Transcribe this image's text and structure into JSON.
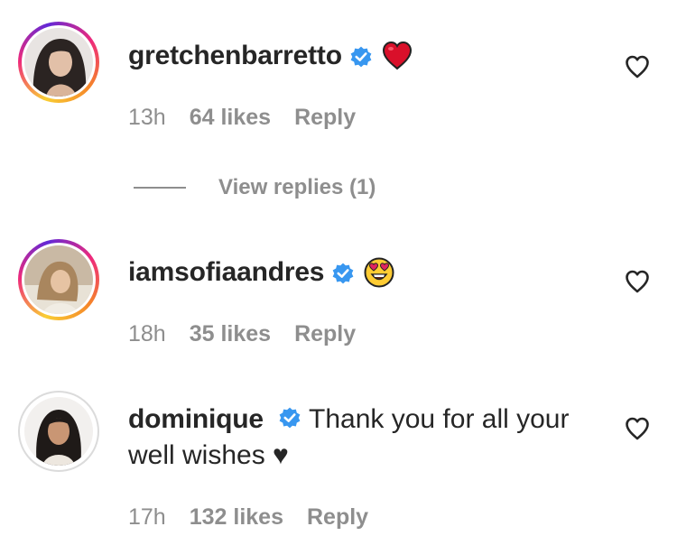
{
  "comments": [
    {
      "username": "gretchenbarretto",
      "verified": true,
      "emoji": "red-heart",
      "time": "13h",
      "likes": "64 likes",
      "reply_label": "Reply",
      "view_replies": "View replies (1)"
    },
    {
      "username": "iamsofiaandres",
      "verified": true,
      "emoji": "heart-eyes-face",
      "time": "18h",
      "likes": "35 likes",
      "reply_label": "Reply"
    },
    {
      "username": "dominique",
      "verified": true,
      "text": "Thank you for all your well wishes ♥",
      "time": "17h",
      "likes": "132 likes",
      "reply_label": "Reply"
    }
  ],
  "colors": {
    "text": "#262626",
    "secondary": "#8e8e8e",
    "verified": "#3897f0",
    "heart_red": "#e0245e"
  }
}
